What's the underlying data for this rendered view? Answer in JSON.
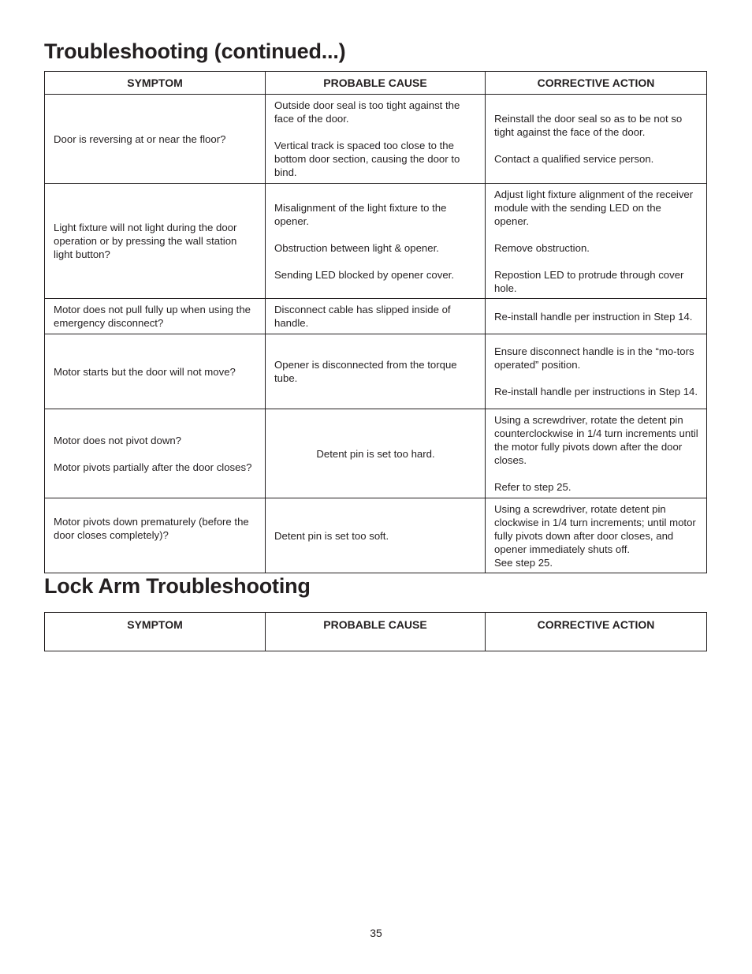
{
  "section1": {
    "title": "Troubleshooting (continued...)",
    "headers": [
      "SYMPTOM",
      "PROBABLE CAUSE",
      "CORRECTIVE ACTION"
    ],
    "rows": [
      {
        "symptom": [
          "Door is reversing at or near the floor?"
        ],
        "cause": [
          "Outside door seal is too tight against the face of the door.",
          "Vertical track is spaced too close to the bottom door section, causing the door to bind."
        ],
        "action": [
          "Reinstall the door seal so as to be not so tight against the face of the door.",
          "Contact a qualified service person."
        ]
      },
      {
        "symptom": [
          "Light fixture will not light during the door operation or by pressing the wall station light button?"
        ],
        "cause": [
          "Misalignment of the light fixture to the opener.",
          "Obstruction between light & opener.",
          "Sending LED blocked by opener cover."
        ],
        "action": [
          "Adjust light fixture alignment of the receiver module with the sending LED on the opener.",
          "Remove obstruction.",
          "Repostion LED to protrude through cover hole."
        ]
      },
      {
        "symptom": [
          "Motor does not pull fully up when using the emergency disconnect?"
        ],
        "cause": [
          "Disconnect cable has slipped inside of handle."
        ],
        "action": [
          "Re-install handle per instruction in Step 14."
        ]
      },
      {
        "symptom": [
          "Motor starts but the door will not move?"
        ],
        "cause": [
          "Opener is disconnected from the torque tube."
        ],
        "action": [
          "Ensure disconnect handle is in the “mo-tors operated” position.",
          "Re-install handle per instructions in Step 14."
        ]
      },
      {
        "symptom": [
          "Motor does not pivot down?",
          "Motor pivots partially after the door closes?"
        ],
        "cause": [
          "Detent pin is set too hard."
        ],
        "action": [
          "Using a screwdriver, rotate the detent pin counterclockwise in 1/4 turn increments until the motor fully pivots down after the door closes.",
          "Refer to step 25."
        ]
      },
      {
        "symptom": [
          "Motor pivots down prematurely (before the door closes completely)?"
        ],
        "cause": [
          "Detent pin is set too soft."
        ],
        "action": [
          "Using a screwdriver, rotate detent pin clockwise in 1/4 turn increments; until motor fully pivots down after door closes, and opener immediately shuts off.",
          "See step 25."
        ]
      }
    ]
  },
  "section2": {
    "title": "Lock Arm Troubleshooting",
    "headers": [
      "SYMPTOM",
      "PROBABLE CAUSE",
      "CORRECTIVE ACTION"
    ]
  },
  "footer": {
    "page_number": "35"
  }
}
